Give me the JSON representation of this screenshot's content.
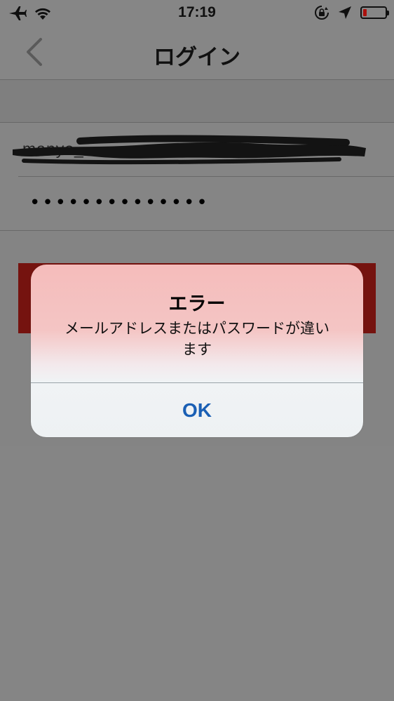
{
  "status_bar": {
    "time": "17:19",
    "icons": [
      "airplane-icon",
      "wifi-icon",
      "orientation-lock-icon",
      "location-arrow-icon",
      "battery-icon"
    ],
    "battery_level_fraction": 0.15,
    "battery_color": "#b3120e"
  },
  "nav": {
    "title": "ログイン",
    "back_icon": "chevron-left-icon"
  },
  "form": {
    "email_value": "manyo_",
    "password_value": "••••••••••••••"
  },
  "login_button": {
    "color": "#7a1410"
  },
  "alert": {
    "title": "エラー",
    "message_line1": "メールアドレスまたはパスワードが違い",
    "message_line2": "ます",
    "ok_label": "OK",
    "ok_color": "#1a5fb4"
  }
}
